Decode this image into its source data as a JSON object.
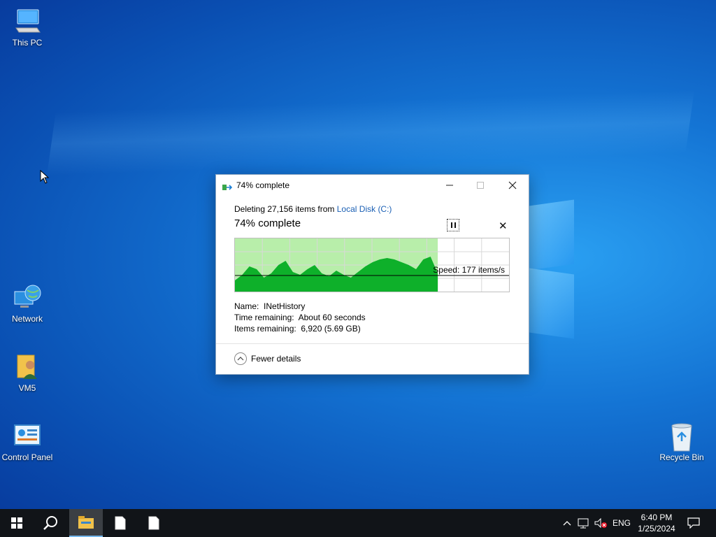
{
  "desktop": {
    "icons": [
      {
        "label": "This PC",
        "icon": "this-pc-icon"
      },
      {
        "label": "Network",
        "icon": "network-icon"
      },
      {
        "label": "VM5",
        "icon": "user-folder-icon"
      },
      {
        "label": "Control Panel",
        "icon": "control-panel-icon"
      },
      {
        "label": "Recycle Bin",
        "icon": "recycle-bin-icon"
      }
    ]
  },
  "dialog": {
    "title": "74% complete",
    "operation_prefix": "Deleting 27,156 items from",
    "location": "Local Disk (C:)",
    "percent_text": "74% complete",
    "progress": 0.74,
    "speed_text": "Speed: 177 items/s",
    "name_label": "Name:",
    "name_value": "INetHistory",
    "time_label": "Time remaining:",
    "time_value": "About 60 seconds",
    "items_label": "Items remaining:",
    "items_value": "6,920 (5.69 GB)",
    "fewer_details": "Fewer details",
    "colors": {
      "graph_fill": "#0eb02a",
      "graph_background": "#b8eeaa",
      "link": "#1a5fb4"
    }
  },
  "taskbar": {
    "language": "ENG",
    "time": "6:40 PM",
    "date": "1/25/2024"
  }
}
